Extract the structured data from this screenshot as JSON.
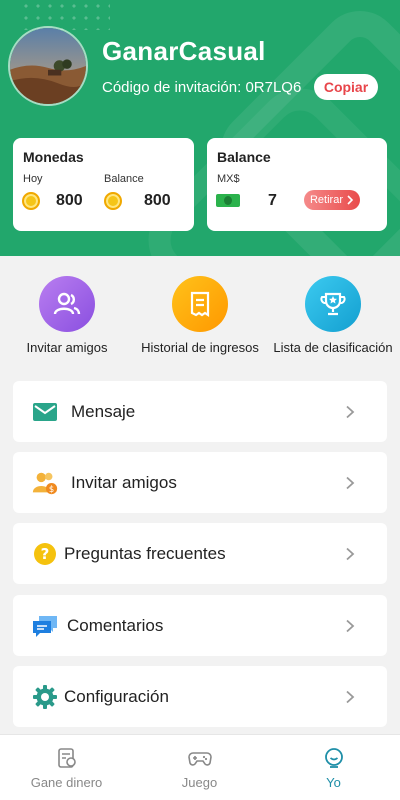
{
  "profile": {
    "username": "GanarCasual",
    "invite_label": "Código de invitación:",
    "invite_code": "0R7LQ6",
    "copy_label": "Copiar"
  },
  "coins_card": {
    "title": "Monedas",
    "today_label": "Hoy",
    "today_value": "800",
    "balance_label": "Balance",
    "balance_value": "800"
  },
  "balance_card": {
    "title": "Balance",
    "currency": "MX$",
    "value": "7",
    "withdraw_label": "Retirar"
  },
  "shortcuts": [
    {
      "label": "Invitar amigos",
      "icon": "invite-friends-icon",
      "color": "#9b5de5"
    },
    {
      "label": "Historial de ingresos",
      "icon": "receipt-icon",
      "color": "#ff9f00"
    },
    {
      "label": "Lista de clasificación",
      "icon": "trophy-icon",
      "color": "#1fb5e0"
    }
  ],
  "menu": [
    {
      "label": "Mensaje",
      "icon": "envelope-icon"
    },
    {
      "label": "Invitar amigos",
      "icon": "users-coin-icon"
    },
    {
      "label": "Preguntas frecuentes",
      "icon": "question-icon"
    },
    {
      "label": "Comentarios",
      "icon": "chat-bubbles-icon"
    },
    {
      "label": "Configuración",
      "icon": "gear-icon"
    }
  ],
  "nav": [
    {
      "label": "Gane dinero",
      "icon": "earn-icon",
      "active": false
    },
    {
      "label": "Juego",
      "icon": "gamepad-icon",
      "active": false
    },
    {
      "label": "Yo",
      "icon": "profile-icon",
      "active": true
    }
  ],
  "colors": {
    "header_green": "#22a76c",
    "accent_red": "#e8454a",
    "active_nav": "#1f8fa8"
  }
}
